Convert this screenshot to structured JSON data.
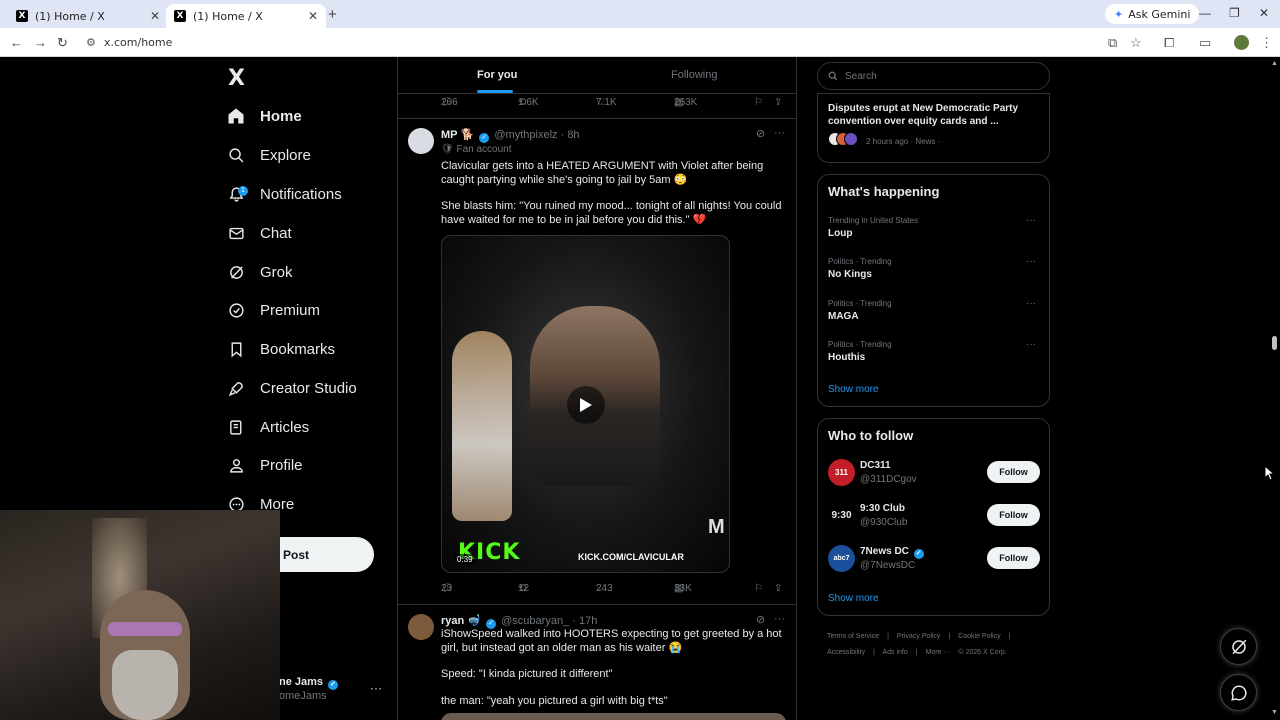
{
  "browser": {
    "tabs": [
      {
        "title": "(1) Home / X"
      },
      {
        "title": "(1) Home / X"
      }
    ],
    "new_tab": "+",
    "gemini_label": "Ask Gemini",
    "url": "x.com/home"
  },
  "nav": {
    "logo": "X",
    "notifications_badge": "1",
    "items": [
      {
        "label": "Home",
        "icon": "home-icon"
      },
      {
        "label": "Explore",
        "icon": "search-icon"
      },
      {
        "label": "Notifications",
        "icon": "bell-icon"
      },
      {
        "label": "Chat",
        "icon": "mail-icon"
      },
      {
        "label": "Grok",
        "icon": "grok-icon"
      },
      {
        "label": "Premium",
        "icon": "verified-icon"
      },
      {
        "label": "Bookmarks",
        "icon": "bookmark-icon"
      },
      {
        "label": "Creator Studio",
        "icon": "rocket-icon"
      },
      {
        "label": "Articles",
        "icon": "article-icon"
      },
      {
        "label": "Profile",
        "icon": "person-icon"
      },
      {
        "label": "More",
        "icon": "more-circle-icon"
      }
    ],
    "post_button": "Post",
    "account": {
      "name": "ne Jams",
      "handle": "omeJams"
    }
  },
  "feed": {
    "tabs": {
      "for_you": "For you",
      "following": "Following"
    },
    "top_actions": {
      "replies": "266",
      "reposts": "1.6K",
      "likes": "7.1K",
      "views": "263K"
    },
    "post1": {
      "name": "MP",
      "handle": "@mythpixelz",
      "time": "· 8h",
      "fan_label": "Fan account",
      "text1": "Clavicular gets into a HEATED ARGUMENT with Violet after being caught partying while she's going to jail by 5am 😳",
      "text2": "She blasts him: \"You ruined my mood... tonight of all nights! You could have waited for me to be in jail before you did this.\" 💔",
      "video": {
        "duration": "0:39",
        "watermark": "KICK",
        "watermark_url": "KICK.COM/CLAVICULAR"
      },
      "actions": {
        "replies": "23",
        "reposts": "12",
        "likes": "243",
        "views": "33K"
      }
    },
    "post2": {
      "name": "ryan",
      "handle": "@scubaryan_",
      "time": "· 17h",
      "text1": "iShowSpeed walked into HOOTERS expecting to get greeted by a hot girl, but instead got an older man as his waiter 😭",
      "text2": "Speed: \"I kinda pictured it different\"",
      "text3": "the man: \"yeah you pictured a girl with big t*ts\""
    }
  },
  "sidebar": {
    "search_placeholder": "Search",
    "news": {
      "title": "Disputes erupt at New Democratic Party convention over equity cards and ...",
      "meta": "2 hours ago · News ·"
    },
    "happening": {
      "heading": "What's happening",
      "trends": [
        {
          "category": "Trending in United States",
          "name": "Loup"
        },
        {
          "category": "Politics · Trending",
          "name": "No Kings"
        },
        {
          "category": "Politics · Trending",
          "name": "MAGA"
        },
        {
          "category": "Politics · Trending",
          "name": "Houthis"
        }
      ],
      "show_more": "Show more"
    },
    "who_to_follow": {
      "heading": "Who to follow",
      "accounts": [
        {
          "name": "DC311",
          "handle": "@311DCgov",
          "avatar_text": "311",
          "verified": false
        },
        {
          "name": "9:30 Club",
          "handle": "@930Club",
          "avatar_text": "9:30",
          "verified": false
        },
        {
          "name": "7News DC",
          "handle": "@7NewsDC",
          "avatar_text": "abc7",
          "verified": true
        }
      ],
      "follow_label": "Follow",
      "show_more": "Show more"
    },
    "footer": {
      "line1": [
        "Terms of Service",
        "|",
        "Privacy Policy",
        "|",
        "Cookie Policy",
        "|"
      ],
      "line2": [
        "Accessibility",
        "|",
        "Ads info",
        "|",
        "More ···",
        "© 2026 X Corp."
      ]
    }
  },
  "colors": {
    "background": "#000000",
    "accent": "#1d9bf0",
    "text": "#e7e9ea",
    "muted": "#71767b",
    "border": "#2f3336"
  }
}
